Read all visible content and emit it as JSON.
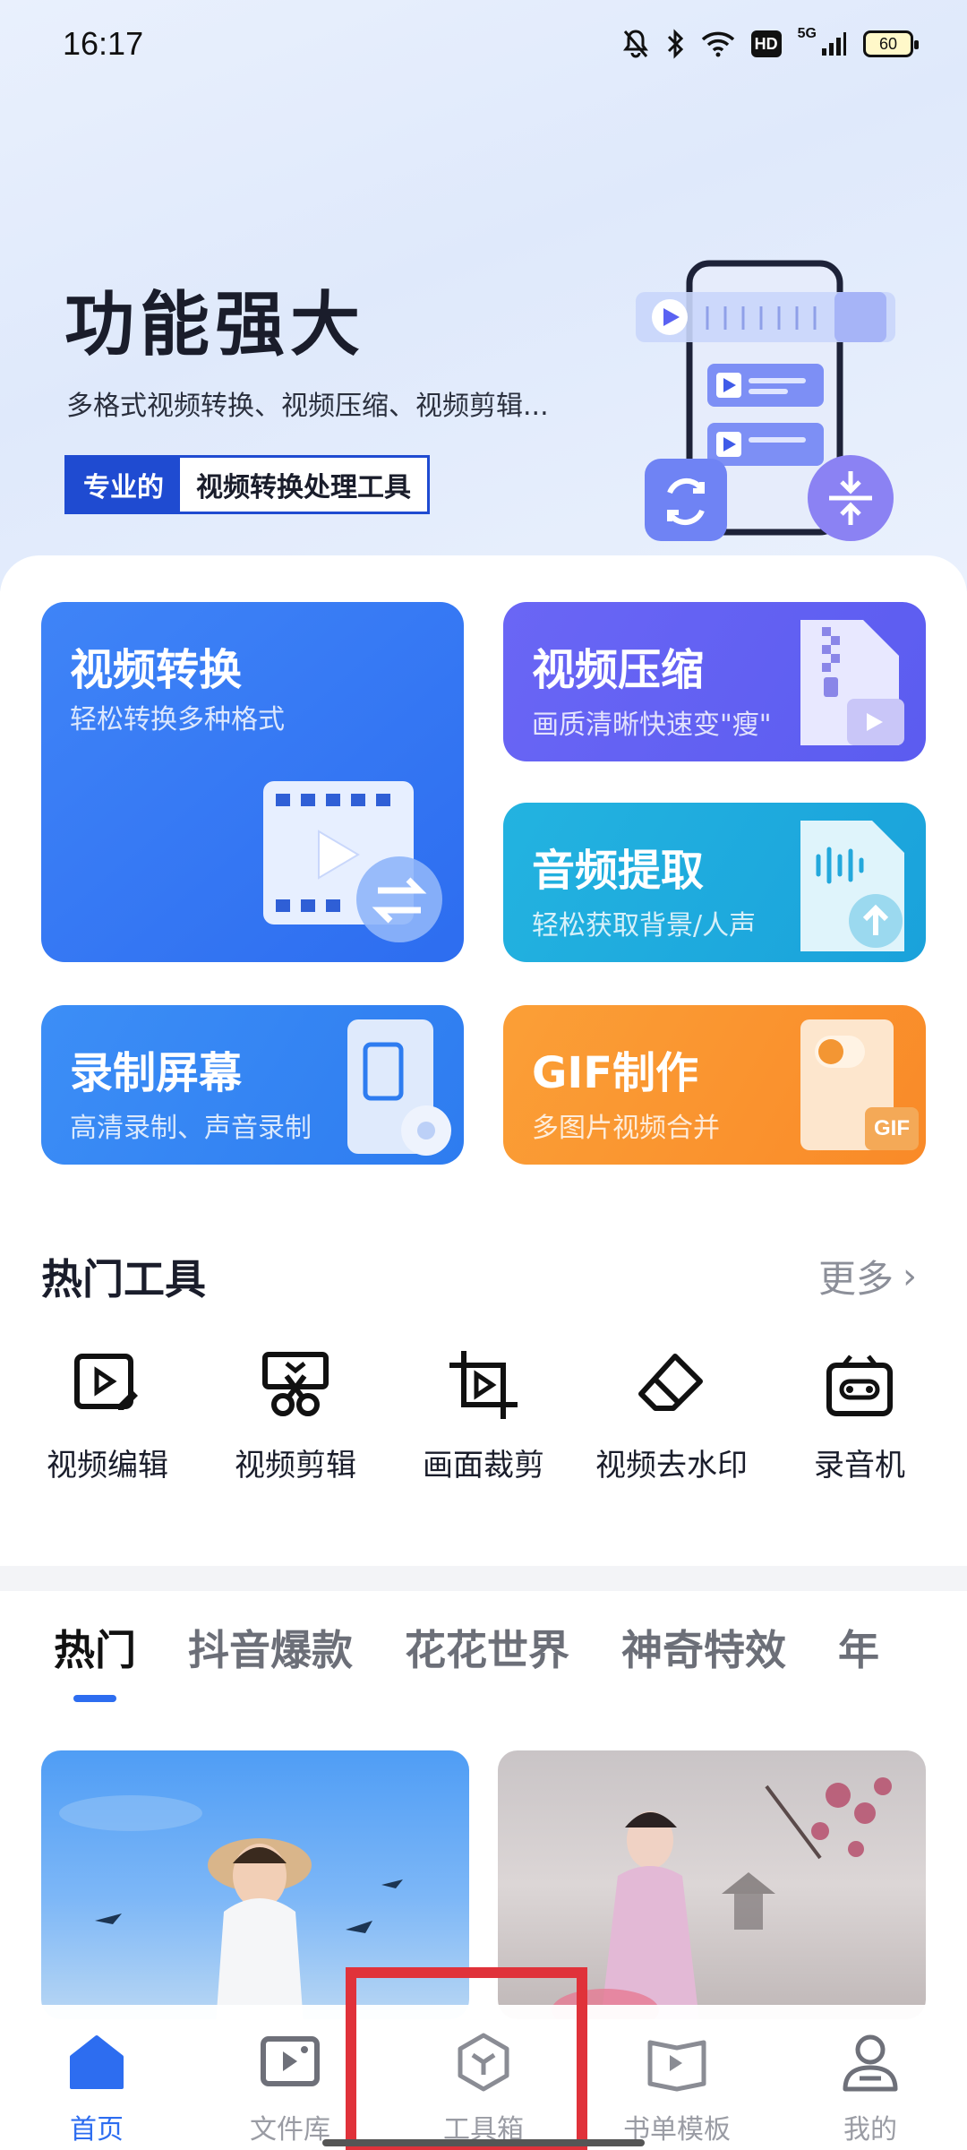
{
  "status_bar": {
    "time": "16:17",
    "network": "5G",
    "hd": "HD",
    "battery": "60"
  },
  "hero": {
    "title": "功能强大",
    "subtitle": "多格式视频转换、视频压缩、视频剪辑...",
    "tag_primary": "专业的",
    "tag_secondary": "视频转换处理工具"
  },
  "features": [
    {
      "title": "视频转换",
      "subtitle": "轻松转换多种格式"
    },
    {
      "title": "视频压缩",
      "subtitle": "画质清晰快速变\"瘦\""
    },
    {
      "title": "音频提取",
      "subtitle": "轻松获取背景/人声"
    },
    {
      "title": "录制屏幕",
      "subtitle": "高清录制、声音录制"
    },
    {
      "title": "GIF制作",
      "subtitle": "多图片视频合并",
      "badge": "GIF"
    }
  ],
  "hot_tools": {
    "title": "热门工具",
    "more": "更多",
    "items": [
      {
        "label": "视频编辑",
        "icon": "video-edit-icon"
      },
      {
        "label": "视频剪辑",
        "icon": "scissors-icon"
      },
      {
        "label": "画面裁剪",
        "icon": "crop-icon"
      },
      {
        "label": "视频去水印",
        "icon": "eraser-icon"
      },
      {
        "label": "录音机",
        "icon": "recorder-icon"
      }
    ]
  },
  "tabs": [
    "热门",
    "抖音爆款",
    "花花世界",
    "神奇特效",
    "年"
  ],
  "active_tab": 0,
  "bottom_nav": [
    {
      "label": "首页",
      "icon": "home-icon",
      "active": true
    },
    {
      "label": "文件库",
      "icon": "media-library-icon",
      "active": false
    },
    {
      "label": "工具箱",
      "icon": "toolbox-icon",
      "active": false
    },
    {
      "label": "书单模板",
      "icon": "book-template-icon",
      "active": false
    },
    {
      "label": "我的",
      "icon": "profile-icon",
      "active": false
    }
  ],
  "colors": {
    "primary": "#2d6df0",
    "convert_card": "#3f84f7",
    "compress_card": "#6a66f5",
    "audio_card": "#1fabdf",
    "record_card": "#3c8ef6",
    "gif_card": "#fb9f37",
    "highlight": "#e0323a"
  }
}
